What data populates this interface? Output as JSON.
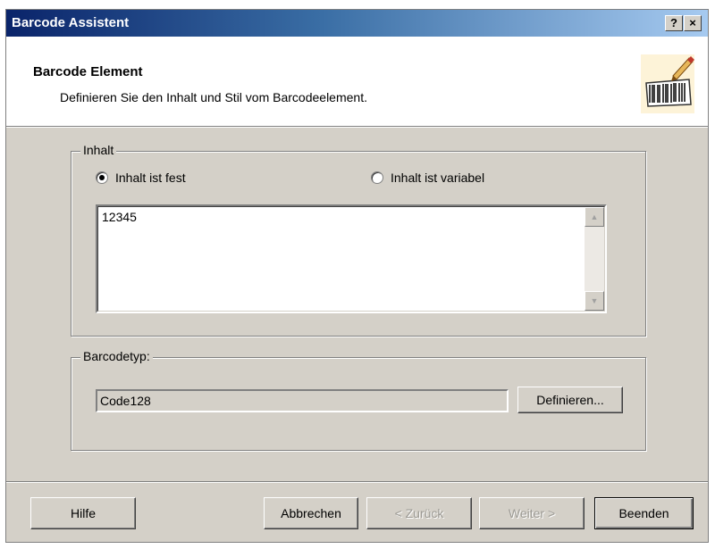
{
  "window": {
    "title": "Barcode Assistent",
    "help_button": "?",
    "close_button": "×"
  },
  "header": {
    "title": "Barcode Element",
    "subtitle": "Definieren Sie den Inhalt und Stil vom Barcodeelement.",
    "icon": "barcode-wizard-icon"
  },
  "content_group": {
    "label": "Inhalt",
    "radio_fixed": {
      "label": "Inhalt ist fest",
      "checked": true
    },
    "radio_variable": {
      "label": "Inhalt ist variabel",
      "checked": false
    },
    "text_value": "12345"
  },
  "barcode_group": {
    "label": "Barcodetyp:",
    "value": "Code128",
    "define_button": "Definieren..."
  },
  "footer": {
    "help": "Hilfe",
    "cancel": "Abbrechen",
    "back": "< Zurück",
    "next": "Weiter >",
    "finish": "Beenden"
  },
  "colors": {
    "title_gradient_start": "#0a246a",
    "title_gradient_end": "#a6caf0",
    "dialog_face": "#d4d0c8"
  }
}
